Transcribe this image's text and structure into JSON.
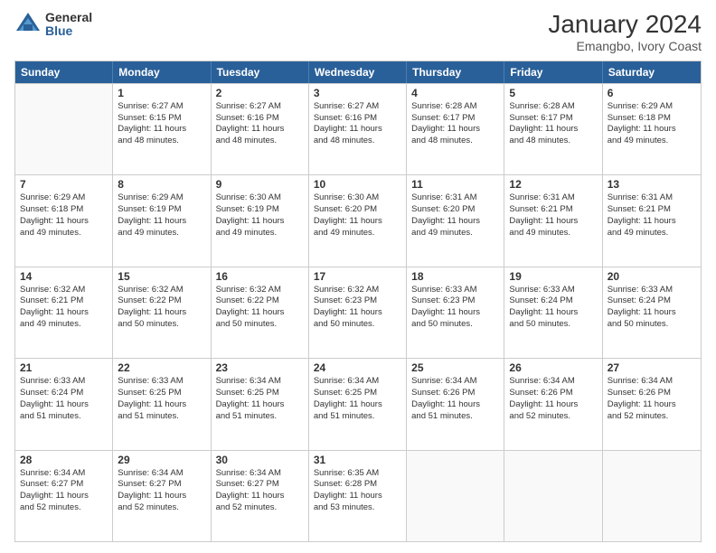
{
  "logo": {
    "general": "General",
    "blue": "Blue"
  },
  "header": {
    "title": "January 2024",
    "subtitle": "Emangbo, Ivory Coast"
  },
  "weekdays": [
    "Sunday",
    "Monday",
    "Tuesday",
    "Wednesday",
    "Thursday",
    "Friday",
    "Saturday"
  ],
  "weeks": [
    [
      {
        "day": "",
        "info": ""
      },
      {
        "day": "1",
        "info": "Sunrise: 6:27 AM\nSunset: 6:15 PM\nDaylight: 11 hours\nand 48 minutes."
      },
      {
        "day": "2",
        "info": "Sunrise: 6:27 AM\nSunset: 6:16 PM\nDaylight: 11 hours\nand 48 minutes."
      },
      {
        "day": "3",
        "info": "Sunrise: 6:27 AM\nSunset: 6:16 PM\nDaylight: 11 hours\nand 48 minutes."
      },
      {
        "day": "4",
        "info": "Sunrise: 6:28 AM\nSunset: 6:17 PM\nDaylight: 11 hours\nand 48 minutes."
      },
      {
        "day": "5",
        "info": "Sunrise: 6:28 AM\nSunset: 6:17 PM\nDaylight: 11 hours\nand 48 minutes."
      },
      {
        "day": "6",
        "info": "Sunrise: 6:29 AM\nSunset: 6:18 PM\nDaylight: 11 hours\nand 49 minutes."
      }
    ],
    [
      {
        "day": "7",
        "info": "Sunrise: 6:29 AM\nSunset: 6:18 PM\nDaylight: 11 hours\nand 49 minutes."
      },
      {
        "day": "8",
        "info": "Sunrise: 6:29 AM\nSunset: 6:19 PM\nDaylight: 11 hours\nand 49 minutes."
      },
      {
        "day": "9",
        "info": "Sunrise: 6:30 AM\nSunset: 6:19 PM\nDaylight: 11 hours\nand 49 minutes."
      },
      {
        "day": "10",
        "info": "Sunrise: 6:30 AM\nSunset: 6:20 PM\nDaylight: 11 hours\nand 49 minutes."
      },
      {
        "day": "11",
        "info": "Sunrise: 6:31 AM\nSunset: 6:20 PM\nDaylight: 11 hours\nand 49 minutes."
      },
      {
        "day": "12",
        "info": "Sunrise: 6:31 AM\nSunset: 6:21 PM\nDaylight: 11 hours\nand 49 minutes."
      },
      {
        "day": "13",
        "info": "Sunrise: 6:31 AM\nSunset: 6:21 PM\nDaylight: 11 hours\nand 49 minutes."
      }
    ],
    [
      {
        "day": "14",
        "info": "Sunrise: 6:32 AM\nSunset: 6:21 PM\nDaylight: 11 hours\nand 49 minutes."
      },
      {
        "day": "15",
        "info": "Sunrise: 6:32 AM\nSunset: 6:22 PM\nDaylight: 11 hours\nand 50 minutes."
      },
      {
        "day": "16",
        "info": "Sunrise: 6:32 AM\nSunset: 6:22 PM\nDaylight: 11 hours\nand 50 minutes."
      },
      {
        "day": "17",
        "info": "Sunrise: 6:32 AM\nSunset: 6:23 PM\nDaylight: 11 hours\nand 50 minutes."
      },
      {
        "day": "18",
        "info": "Sunrise: 6:33 AM\nSunset: 6:23 PM\nDaylight: 11 hours\nand 50 minutes."
      },
      {
        "day": "19",
        "info": "Sunrise: 6:33 AM\nSunset: 6:24 PM\nDaylight: 11 hours\nand 50 minutes."
      },
      {
        "day": "20",
        "info": "Sunrise: 6:33 AM\nSunset: 6:24 PM\nDaylight: 11 hours\nand 50 minutes."
      }
    ],
    [
      {
        "day": "21",
        "info": "Sunrise: 6:33 AM\nSunset: 6:24 PM\nDaylight: 11 hours\nand 51 minutes."
      },
      {
        "day": "22",
        "info": "Sunrise: 6:33 AM\nSunset: 6:25 PM\nDaylight: 11 hours\nand 51 minutes."
      },
      {
        "day": "23",
        "info": "Sunrise: 6:34 AM\nSunset: 6:25 PM\nDaylight: 11 hours\nand 51 minutes."
      },
      {
        "day": "24",
        "info": "Sunrise: 6:34 AM\nSunset: 6:25 PM\nDaylight: 11 hours\nand 51 minutes."
      },
      {
        "day": "25",
        "info": "Sunrise: 6:34 AM\nSunset: 6:26 PM\nDaylight: 11 hours\nand 51 minutes."
      },
      {
        "day": "26",
        "info": "Sunrise: 6:34 AM\nSunset: 6:26 PM\nDaylight: 11 hours\nand 52 minutes."
      },
      {
        "day": "27",
        "info": "Sunrise: 6:34 AM\nSunset: 6:26 PM\nDaylight: 11 hours\nand 52 minutes."
      }
    ],
    [
      {
        "day": "28",
        "info": "Sunrise: 6:34 AM\nSunset: 6:27 PM\nDaylight: 11 hours\nand 52 minutes."
      },
      {
        "day": "29",
        "info": "Sunrise: 6:34 AM\nSunset: 6:27 PM\nDaylight: 11 hours\nand 52 minutes."
      },
      {
        "day": "30",
        "info": "Sunrise: 6:34 AM\nSunset: 6:27 PM\nDaylight: 11 hours\nand 52 minutes."
      },
      {
        "day": "31",
        "info": "Sunrise: 6:35 AM\nSunset: 6:28 PM\nDaylight: 11 hours\nand 53 minutes."
      },
      {
        "day": "",
        "info": ""
      },
      {
        "day": "",
        "info": ""
      },
      {
        "day": "",
        "info": ""
      }
    ]
  ]
}
